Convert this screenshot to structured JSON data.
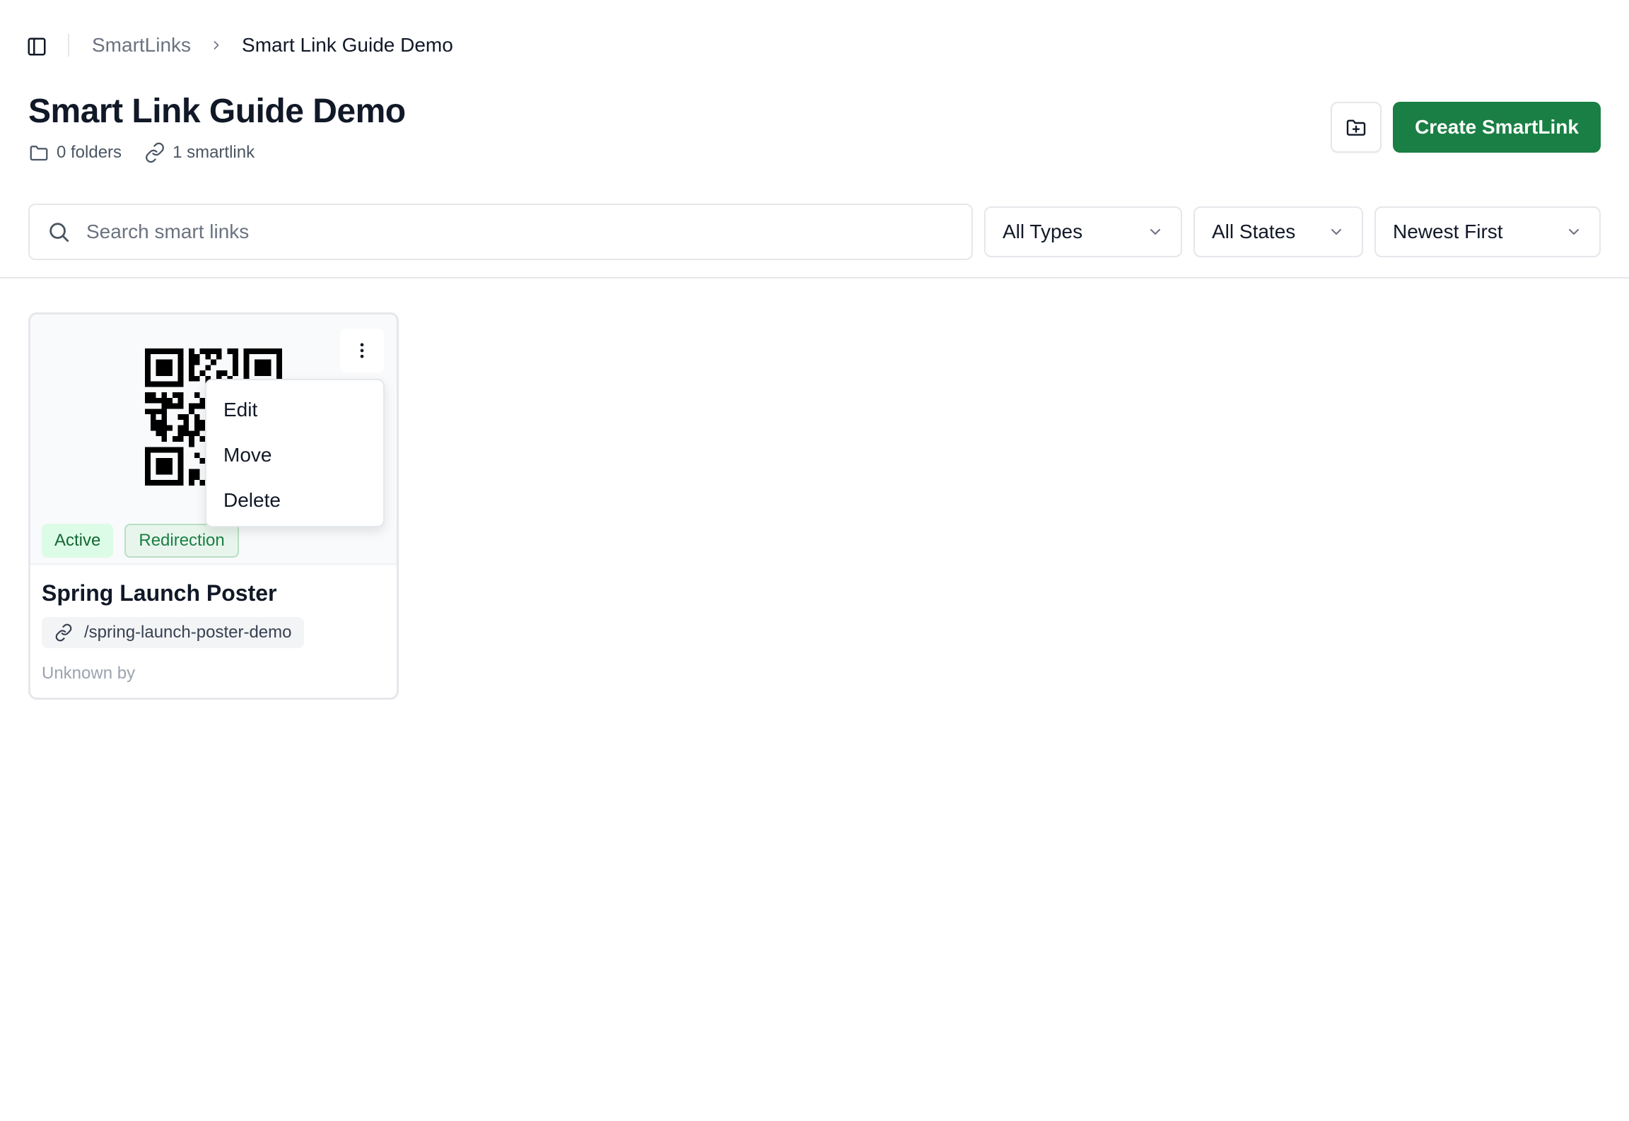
{
  "breadcrumb": {
    "parent": "SmartLinks",
    "current": "Smart Link Guide Demo"
  },
  "header": {
    "title": "Smart Link Guide Demo",
    "folders_count": "0 folders",
    "smartlinks_count": "1 smartlink",
    "create_label": "Create SmartLink"
  },
  "filters": {
    "search_placeholder": "Search smart links",
    "search_value": "",
    "type": "All Types",
    "state": "All States",
    "sort": "Newest First"
  },
  "cards": [
    {
      "title": "Spring Launch Poster",
      "slug": "/spring-launch-poster-demo",
      "status": "Active",
      "type": "Redirection",
      "footer": "Unknown by"
    }
  ],
  "menu": {
    "items": [
      "Edit",
      "Move",
      "Delete"
    ]
  },
  "colors": {
    "primary": "#1a7f44",
    "active_badge_bg": "#dcfce7",
    "active_badge_text": "#166534",
    "border": "#e5e7eb"
  },
  "icons": {
    "sidebar_toggle": "sidebar-panel-icon",
    "breadcrumb_separator": "chevron-right-icon",
    "folders": "folder-icon",
    "smartlinks": "link-icon",
    "new_folder": "folder-plus-icon",
    "search": "search-icon",
    "select": "chevron-down-icon",
    "more": "vertical-ellipsis-icon"
  }
}
